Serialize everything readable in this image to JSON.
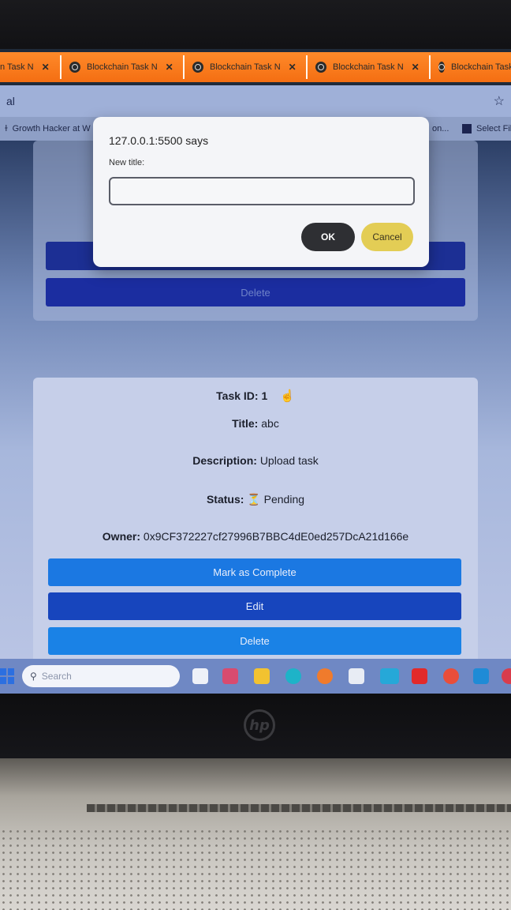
{
  "browser": {
    "tabs": [
      {
        "label": "n Task N",
        "close": "✕"
      },
      {
        "label": "Blockchain Task N",
        "close": "✕"
      },
      {
        "label": "Blockchain Task N",
        "close": "✕"
      },
      {
        "label": "Blockchain Task N",
        "close": "✕"
      },
      {
        "label": "Blockchain Task",
        "close": ""
      }
    ],
    "address_fragment": "al",
    "star_icon": "star-icon",
    "bookmarks": {
      "left": "Growth Hacker at W",
      "middle": "on...",
      "right": "Select Fil"
    }
  },
  "dialog": {
    "origin": "127.0.0.1:5500 says",
    "prompt": "New title:",
    "input_value": "",
    "ok_label": "OK",
    "cancel_label": "Cancel"
  },
  "previous_card": {
    "delete_label": "Delete"
  },
  "task": {
    "id_label": "Task ID:",
    "id_value": "1",
    "title_label": "Title:",
    "title_value": "abc",
    "description_label": "Description:",
    "description_value": "Upload task",
    "status_label": "Status:",
    "status_icon": "⏳",
    "status_value": "Pending",
    "owner_label": "Owner:",
    "owner_value": "0x9CF372227cf27996B7BBC4dE0ed257DcA21d166e",
    "buttons": {
      "complete": "Mark as Complete",
      "edit": "Edit",
      "delete": "Delete"
    }
  },
  "taskbar": {
    "search_placeholder": "Search"
  },
  "colors": {
    "tab_strip": "#f46e12",
    "complete_button": "#1b78e2",
    "edit_button": "#1745bd",
    "delete_button": "#1a82e6",
    "ok_button": "#2e2f33",
    "cancel_button": "#e3cd55"
  },
  "device": {
    "logo": "hp"
  }
}
